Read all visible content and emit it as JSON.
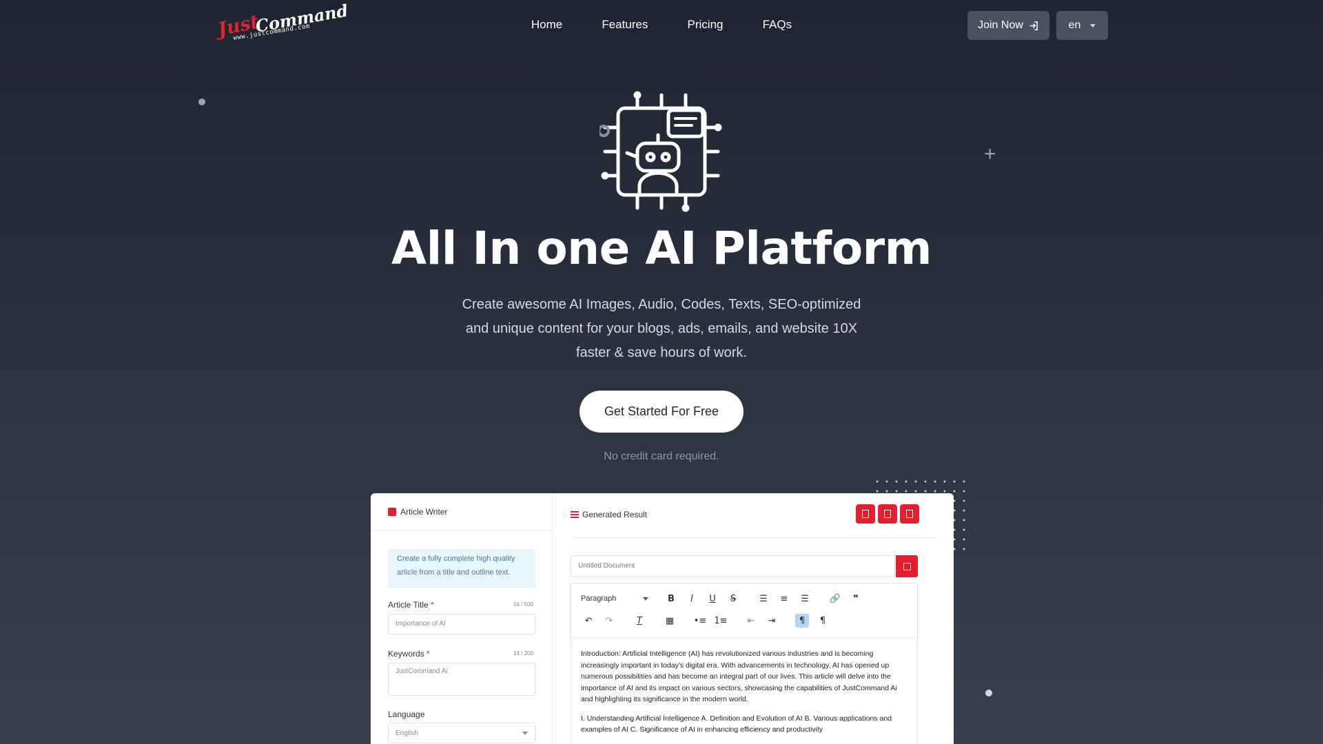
{
  "header": {
    "logo": {
      "just": "Just",
      "command": "Command",
      "url": "www.justcommand.com"
    },
    "nav": [
      "Home",
      "Features",
      "Pricing",
      "FAQs"
    ],
    "join_label": "Join Now",
    "lang_value": "en"
  },
  "hero": {
    "title": "All In one AI Platform",
    "subtitle": "Create awesome AI Images, Audio, Codes, Texts, SEO-optimized and unique content for your blogs, ads, emails, and website 10X faster & save hours of work.",
    "cta_label": "Get Started For Free",
    "note": "No credit card required."
  },
  "mockup": {
    "left": {
      "title": "Article Writer",
      "info": "Create a fully complete high quality article from a title and outline text.",
      "article_title_label": "Article Title",
      "article_title_count": "16 / 500",
      "article_title_value": "Importance of AI",
      "keywords_label": "Keywords",
      "keywords_count": "14 / 200",
      "keywords_value": "JustCommand Ai",
      "language_label": "Language",
      "language_value": "English",
      "required_mark": "*"
    },
    "right": {
      "title": "Generated Result",
      "doc_title_placeholder": "Untitled Document",
      "paragraph_select": "Paragraph",
      "body": [
        "Introduction: Artificial Intelligence (AI) has revolutionized various industries and is becoming increasingly important in today's digital era. With advancements in technology, AI has opened up numerous possibilities and has become an integral part of our lives. This article will delve into the importance of AI and its impact on various sectors, showcasing the capabilities of JustCommand Ai and highlighting its significance in the modern world.",
        "I. Understanding Artificial Intelligence A. Definition and Evolution of AI B. Various applications and examples of AI C. Significance of AI in enhancing efficiency and productivity"
      ]
    }
  },
  "colors": {
    "accent": "#e0202e",
    "bg_top": "#1f2431",
    "bg_bottom": "#3a404d"
  }
}
